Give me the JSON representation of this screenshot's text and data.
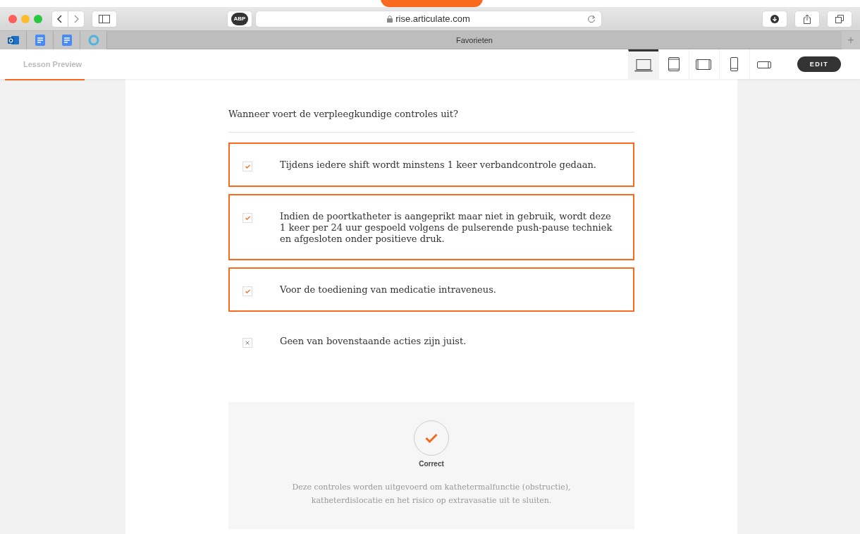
{
  "browser": {
    "adblock_label": "ABP",
    "address": "rise.articulate.com",
    "favorites_label": "Favorieten",
    "new_tab": "+"
  },
  "header": {
    "title": "Lesson Preview",
    "devices": [
      {
        "kind": "laptop",
        "selected": true
      },
      {
        "kind": "tablet",
        "selected": false
      },
      {
        "kind": "tablet-landscape",
        "selected": false
      },
      {
        "kind": "phone",
        "selected": false
      },
      {
        "kind": "phone-landscape",
        "selected": false
      }
    ],
    "edit_label": "EDIT"
  },
  "quiz": {
    "question": "Wanneer voert de verpleegkundige controles uit?",
    "answers": [
      {
        "text": "Tijdens iedere shift wordt minstens 1 keer verbandcontrole gedaan.",
        "selected": true,
        "kind": "check"
      },
      {
        "text": "Indien de poortkatheter is aangeprikt maar niet in gebruik, wordt deze 1 keer per 24 uur gespoeld volgens de pulserende push-pause techniek en afgesloten onder positieve druk.",
        "selected": true,
        "kind": "check"
      },
      {
        "text": "Voor de toediening van medicatie intraveneus.",
        "selected": true,
        "kind": "check"
      },
      {
        "text": "Geen van bovenstaande acties zijn juist.",
        "selected": false,
        "kind": "cross"
      }
    ],
    "feedback": {
      "result": "Correct",
      "correct": true,
      "explanation": "Deze controles worden uitgevoerd om kathetermalfunctie (obstructie), katheterdislocatie en het risico op extravasatie uit te sluiten."
    }
  }
}
